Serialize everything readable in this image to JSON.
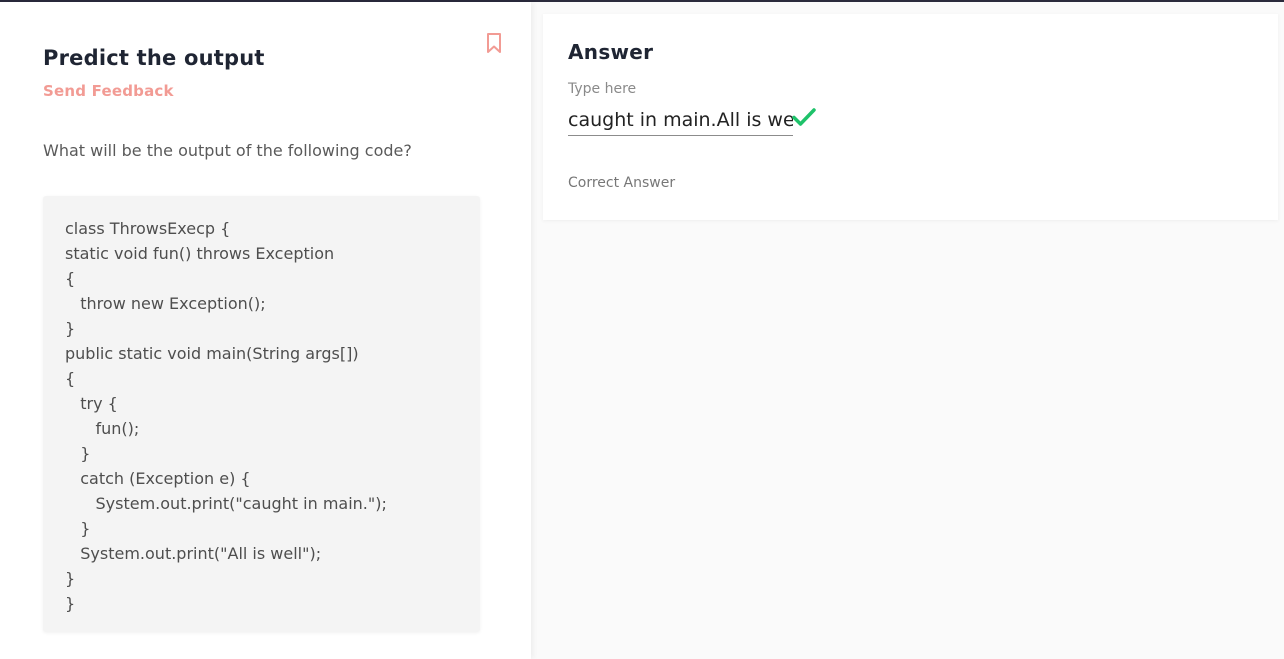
{
  "question": {
    "title": "Predict the output",
    "feedback_label": "Send Feedback",
    "prompt": "What will be the output of the following code?",
    "code_lines": [
      "class ThrowsExecp {",
      "static void fun() throws Exception",
      "{",
      "   throw new Exception();",
      "}",
      "public static void main(String args[])",
      "{",
      "   try {",
      "      fun();",
      "   }",
      "   catch (Exception e) {",
      "      System.out.print(\"caught in main.\");",
      "   }",
      "   System.out.print(\"All is well\");",
      "}",
      "}"
    ],
    "bookmark_icon": "bookmark-icon"
  },
  "answer": {
    "title": "Answer",
    "input_label": "Type here",
    "input_value": "caught in main.All is well",
    "status_icon": "check-icon",
    "status_text": "Correct Answer"
  },
  "colors": {
    "accent": "#f29b94",
    "success": "#1ec26a",
    "heading": "#1f2533"
  }
}
